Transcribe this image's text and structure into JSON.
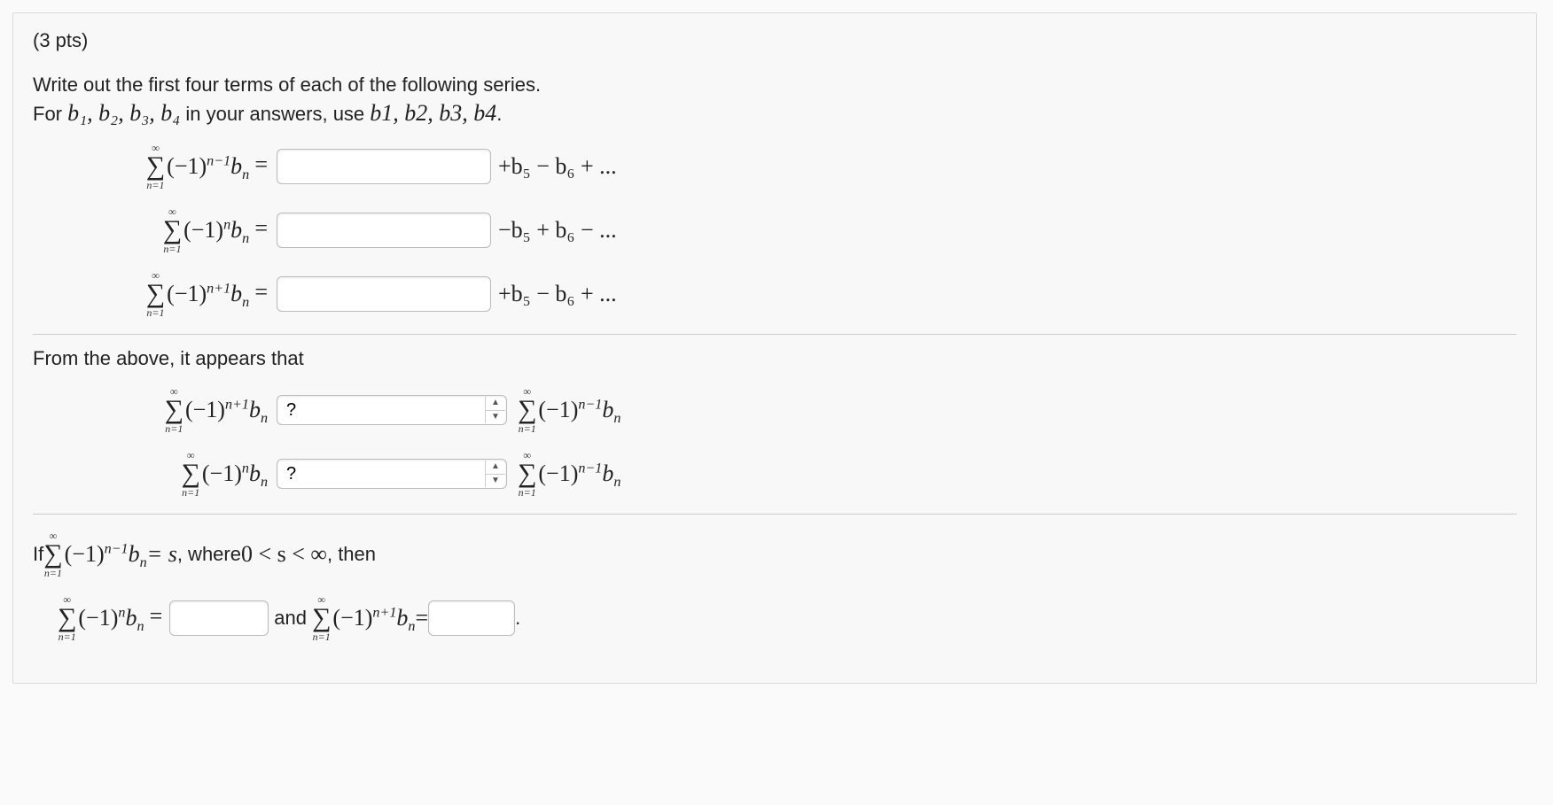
{
  "header": {
    "points": "(3 pts)"
  },
  "prompt": {
    "line1": "Write out the first four terms of each of the following series.",
    "line2_prefix": "For ",
    "line2_vars_math": "b₁, b₂, b₃, b₄",
    "line2_mid": " in your answers, use ",
    "line2_vars_plain": "b1, b2, b3, b4",
    "line2_suffix": "."
  },
  "sigma": {
    "top": "∞",
    "bottom": "n=1",
    "symbol": "∑"
  },
  "series_rows": [
    {
      "exponent": "n−1",
      "tail": "+b₅ − b₆ + ..."
    },
    {
      "exponent": "n",
      "tail": "−b₅ + b₆ − ..."
    },
    {
      "exponent": "n+1",
      "tail": "+b₅ − b₆ + ..."
    }
  ],
  "equals": " = ",
  "section2": {
    "intro": "From the above, it appears that",
    "rows": [
      {
        "left_exp": "n+1",
        "right_exp": "n−1"
      },
      {
        "left_exp": "n",
        "right_exp": "n−1"
      }
    ],
    "select_placeholder": "?"
  },
  "section3": {
    "prefix": "If ",
    "cond_exp": "n−1",
    "cond_eq": " = s",
    "where_text": ", where ",
    "range": "0 < s < ∞",
    "then_text": ", then",
    "row": {
      "left_exp": "n",
      "mid_text": " and ",
      "right_exp": "n+1",
      "period": " ."
    }
  }
}
